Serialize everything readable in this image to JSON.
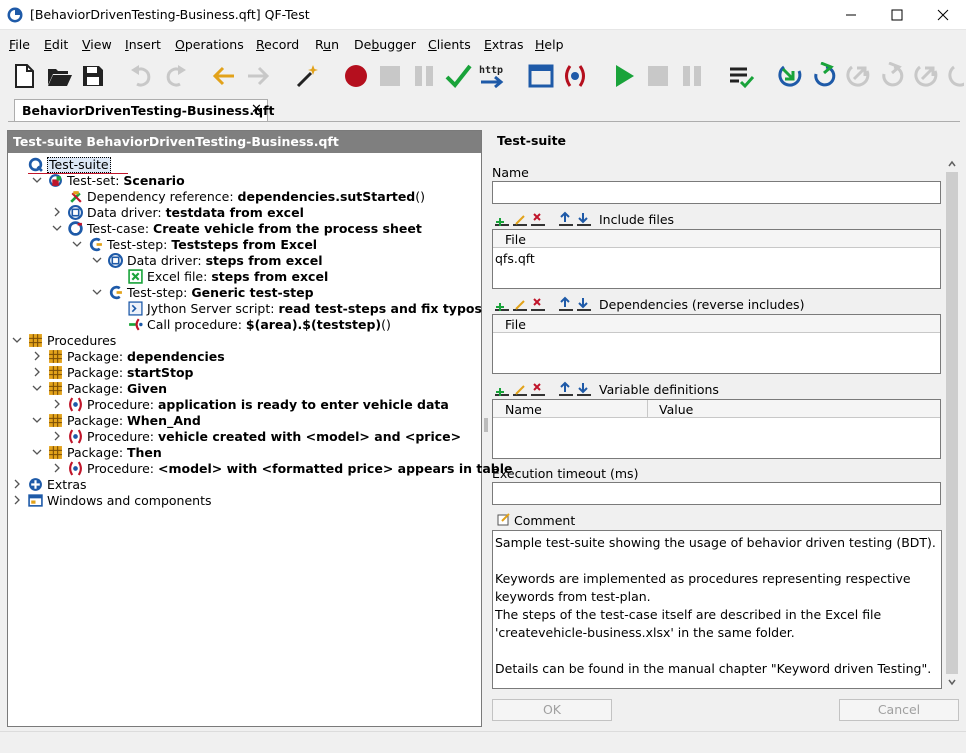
{
  "window": {
    "title": "[BehaviorDrivenTesting-Business.qft] QF-Test"
  },
  "menu": [
    {
      "label": "File",
      "u": "F",
      "rest": "ile"
    },
    {
      "label": "Edit",
      "u": "E",
      "rest": "dit"
    },
    {
      "label": "View",
      "u": "V",
      "rest": "iew"
    },
    {
      "label": "Insert",
      "u": "I",
      "rest": "nsert"
    },
    {
      "label": "Operations",
      "u": "O",
      "rest": "perations"
    },
    {
      "label": "Record",
      "u": "R",
      "rest": "ecord"
    },
    {
      "label": "Run",
      "pre": "R",
      "u": "u",
      "rest": "n"
    },
    {
      "label": "Debugger",
      "pre": "De",
      "u": "b",
      "rest": "ugger"
    },
    {
      "label": "Clients",
      "u": "C",
      "rest": "lients"
    },
    {
      "label": "Extras",
      "u": "E",
      "rest": "xtras"
    },
    {
      "label": "Help",
      "u": "H",
      "rest": "elp"
    }
  ],
  "toolbar": {
    "http_label": "http"
  },
  "tab": {
    "label": "BehaviorDrivenTesting-Business.qft",
    "close": "✕"
  },
  "tree": {
    "header": "Test-suite BehaviorDrivenTesting-Business.qft",
    "nodes": [
      {
        "t": "",
        "b": "Test-suite"
      },
      {
        "t": "Test-set: ",
        "b": "Scenario"
      },
      {
        "t": "Dependency reference: ",
        "b": "dependencies.sutStarted",
        "s": "()"
      },
      {
        "t": "Data driver: ",
        "b": "testdata from excel"
      },
      {
        "t": "Test-case: ",
        "b": "Create vehicle from the process sheet"
      },
      {
        "t": "Test-step: ",
        "b": "Teststeps from Excel"
      },
      {
        "t": "Data driver: ",
        "b": "steps from excel"
      },
      {
        "t": "Excel file: ",
        "b": "steps from excel"
      },
      {
        "t": "Test-step: ",
        "b": "Generic test-step"
      },
      {
        "t": "Jython Server script: ",
        "b": "read test-steps and fix typos"
      },
      {
        "t": "Call procedure: ",
        "b": "$(area).$(teststep)",
        "s": "()"
      },
      {
        "t": "Procedures",
        "b": ""
      },
      {
        "t": "Package: ",
        "b": "dependencies"
      },
      {
        "t": "Package: ",
        "b": "startStop"
      },
      {
        "t": "Package: ",
        "b": "Given"
      },
      {
        "t": "Procedure: ",
        "b": "application is ready to enter vehicle data"
      },
      {
        "t": "Package: ",
        "b": "When_And"
      },
      {
        "t": "Procedure: ",
        "b": "vehicle created with <model> and <price>"
      },
      {
        "t": "Package: ",
        "b": "Then"
      },
      {
        "t": "Procedure: ",
        "b": "<model> with <formatted price> appears in table"
      },
      {
        "t": "Extras",
        "b": ""
      },
      {
        "t": "Windows and components",
        "b": ""
      }
    ]
  },
  "detail": {
    "title": "Test-suite",
    "name_label": "Name",
    "name_value": "",
    "include_label": "Include files",
    "include_col": "File",
    "include_rows": [
      "qfs.qft"
    ],
    "deps_label": "Dependencies (reverse includes)",
    "deps_col": "File",
    "vars_label": "Variable definitions",
    "vars_col_name": "Name",
    "vars_col_value": "Value",
    "timeout_label": "Execution timeout (ms)",
    "timeout_value": "",
    "comment_label": "Comment",
    "comment_lines": [
      "Sample test-suite showing the usage of behavior driven testing (BDT).",
      "",
      "Keywords are implemented as procedures representing respective",
      "keywords from test-plan.",
      "The steps of the test-case itself are described in the Excel file",
      "'createvehicle-business.xlsx' in the same folder.",
      "",
      "Details can be found in the manual chapter \"Keyword driven Testing\"."
    ],
    "ok_label": "OK",
    "cancel_label": "Cancel"
  }
}
